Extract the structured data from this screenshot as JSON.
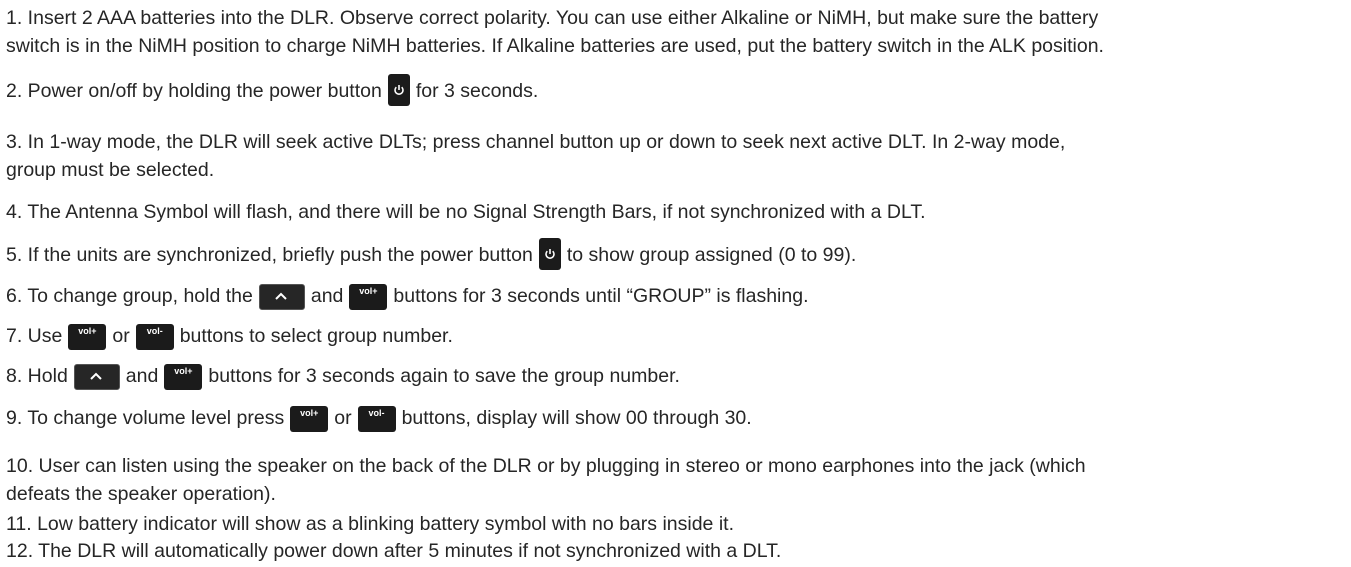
{
  "steps": {
    "s1": {
      "l1": "1. Insert 2 AAA batteries into the DLR. Observe correct polarity.  You can use either Alkaline or NiMH, but make sure the battery",
      "l2": "switch is in the NiMH position to charge NiMH batteries.  If Alkaline batteries are used, put the battery switch in the ALK position."
    },
    "s2": {
      "a": "2. Power on/off by holding the power button",
      "b": "for 3 seconds."
    },
    "s3": {
      "l1": "3. In 1-way mode, the DLR will seek active DLTs; press channel button up or down to seek next active DLT.  In 2-way mode,",
      "l2": "group must be selected."
    },
    "s4": "4. The Antenna Symbol will flash, and there will be no Signal Strength Bars, if not synchronized with a DLT.",
    "s5": {
      "a": "5. If the units are synchronized, briefly push the power button",
      "b": "to show group assigned (0 to 99)."
    },
    "s6": {
      "a": "6. To change group, hold the",
      "b": "and",
      "c": "buttons for 3 seconds until “GROUP” is flashing."
    },
    "s7": {
      "a": "7. Use",
      "b": "or",
      "c": "buttons to select group number."
    },
    "s8": {
      "a": "8. Hold",
      "b": "and",
      "c": "buttons for 3 seconds again to save the group number."
    },
    "s9": {
      "a": "9. To change volume level press",
      "b": "or",
      "c": "buttons, display will show 00 through 30."
    },
    "s10": {
      "l1": "10. User can listen using the speaker on the back of the DLR or by plugging in stereo or mono earphones into the jack (which",
      "l2": "defeats the speaker operation)."
    },
    "s11": "11. Low battery indicator will show as a blinking battery symbol with no bars inside it.",
    "s12": "12. The DLR will automatically power down after 5 minutes if not synchronized with a DLT."
  },
  "buttons": {
    "vol_plus": "vol+",
    "vol_minus": "vol-",
    "power_icon": "power-icon",
    "up_icon": "chevron-up-icon"
  },
  "colors": {
    "text": "#262626",
    "button": "#1b1b1b",
    "button_text": "#ffffff"
  }
}
